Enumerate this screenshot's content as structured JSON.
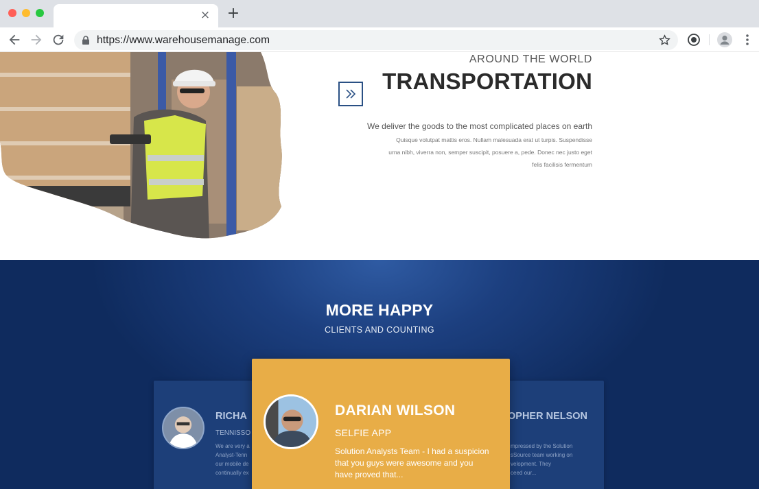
{
  "browser": {
    "url": "https://www.warehousemanage.com",
    "tab_close_symbol": "×",
    "new_tab_symbol": "+"
  },
  "transportation": {
    "kicker": "AROUND THE WORLD",
    "title": "TRANSPORTATION",
    "lead": "We deliver the goods to the most complicated places on earth",
    "body_lines": [
      "Quisque volutpat mattis eros. Nullam malesuada erat ut turpis. Suspendisse",
      "urna nibh, viverra non, semper suscipit, posuere a, pede. Donec nec justo eget",
      "felis facilisis fermentum"
    ]
  },
  "clients": {
    "title": "MORE HAPPY",
    "subtitle": "CLIENTS AND COUNTING",
    "left": {
      "name": "RICHA",
      "role": "TENNISSO",
      "lines": [
        "We are very a",
        "Analyst-Tenn",
        "our mobile de",
        "continually ex"
      ]
    },
    "featured": {
      "name": "DARIAN WILSON",
      "role": "SELFIE APP",
      "quote": "Solution Analysts Team - I had a suspicion that you guys were awesome and you have proved that..."
    },
    "right": {
      "name": "OPHER NELSON",
      "lines": [
        "mpressed by the Solution",
        "sSource team working on",
        "velopment. They",
        "ceed our..."
      ]
    }
  },
  "colors": {
    "accent_navy": "#1c3f7f",
    "featured_card": "#e8ad47",
    "arrow_border": "#2a5084"
  }
}
